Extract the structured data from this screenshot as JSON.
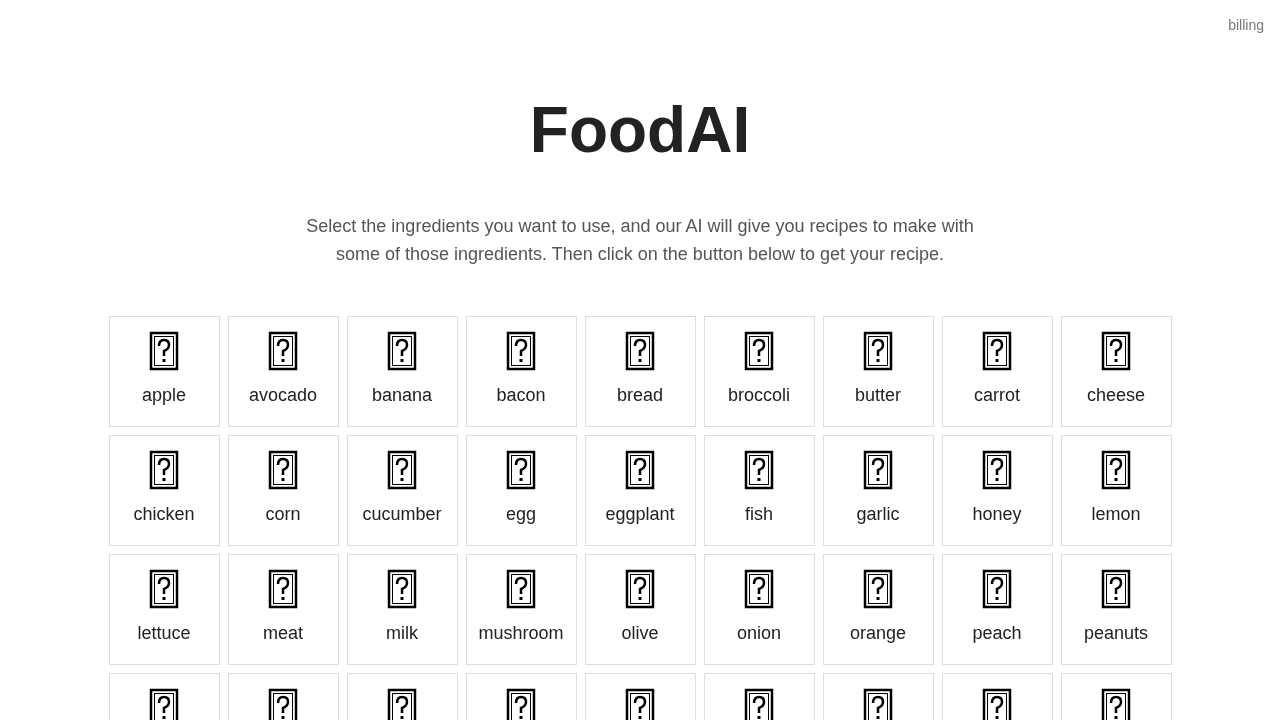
{
  "top_link": "billing",
  "title": "FoodAI",
  "description": "Select the ingredients you want to use, and our AI will give you recipes to make with some of those ingredients. Then click on the button below to get your recipe.",
  "ingredients": [
    {
      "kind": "full",
      "label": "apple"
    },
    {
      "kind": "full",
      "label": "avocado"
    },
    {
      "kind": "full",
      "label": "banana"
    },
    {
      "kind": "full",
      "label": "bacon"
    },
    {
      "kind": "full",
      "label": "bread"
    },
    {
      "kind": "full",
      "label": "broccoli"
    },
    {
      "kind": "full",
      "label": "butter"
    },
    {
      "kind": "full",
      "label": "carrot"
    },
    {
      "kind": "full",
      "label": "cheese"
    },
    {
      "kind": "full",
      "label": "chicken"
    },
    {
      "kind": "full",
      "label": "corn"
    },
    {
      "kind": "full",
      "label": "cucumber"
    },
    {
      "kind": "full",
      "label": "egg"
    },
    {
      "kind": "full",
      "label": "eggplant"
    },
    {
      "kind": "full",
      "label": "fish"
    },
    {
      "kind": "full",
      "label": "garlic"
    },
    {
      "kind": "full",
      "label": "honey"
    },
    {
      "kind": "full",
      "label": "lemon"
    },
    {
      "kind": "full",
      "label": "lettuce"
    },
    {
      "kind": "full",
      "label": "meat"
    },
    {
      "kind": "full",
      "label": "milk"
    },
    {
      "kind": "full",
      "label": "mushroom"
    },
    {
      "kind": "full",
      "label": "olive"
    },
    {
      "kind": "full",
      "label": "onion"
    },
    {
      "kind": "full",
      "label": "orange"
    },
    {
      "kind": "full",
      "label": "peach"
    },
    {
      "kind": "full",
      "label": "peanuts"
    },
    {
      "kind": "cut-off"
    },
    {
      "kind": "cut-off"
    },
    {
      "kind": "cut-off"
    },
    {
      "kind": "cut-off"
    },
    {
      "kind": "cut-off"
    },
    {
      "kind": "cut-off"
    },
    {
      "kind": "cut-off"
    },
    {
      "kind": "cut-off"
    },
    {
      "kind": "cut-off"
    }
  ]
}
